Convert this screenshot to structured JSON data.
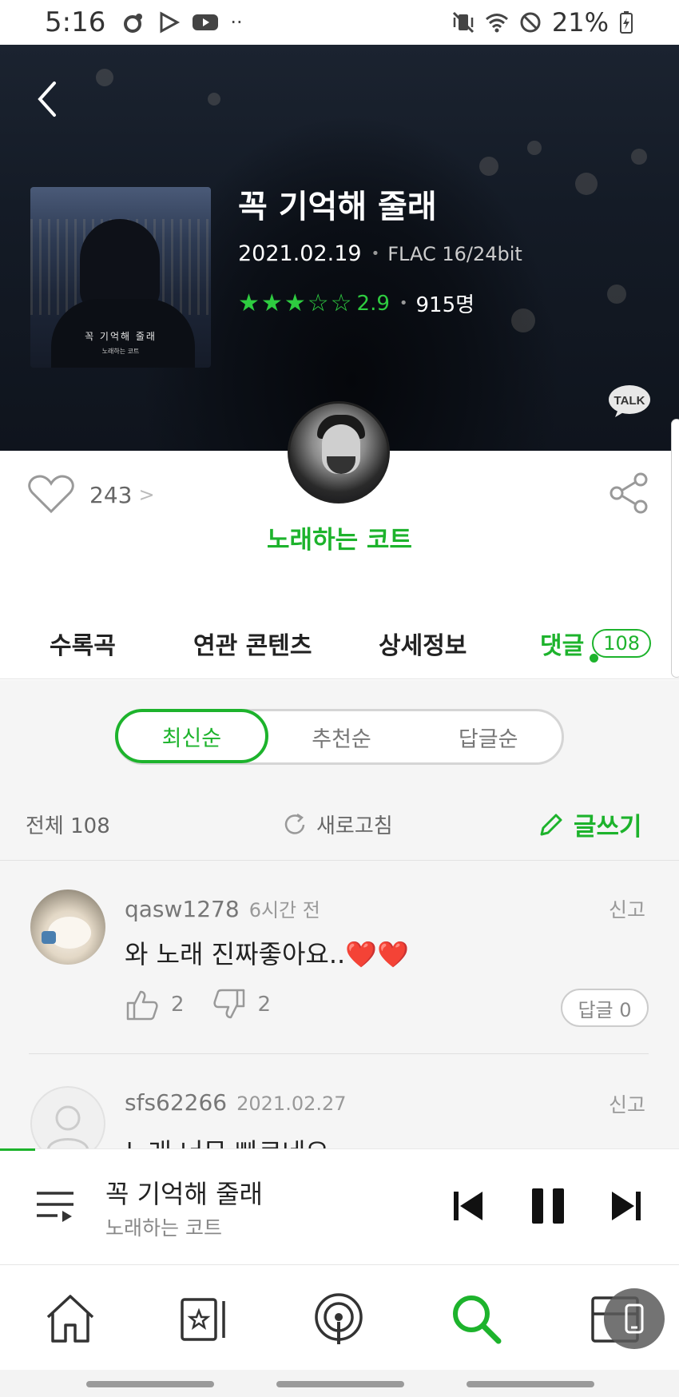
{
  "status_bar": {
    "time": "5:16",
    "battery": "21%"
  },
  "album": {
    "title": "꼭 기억해 줄래",
    "release_date": "2021.02.19",
    "format": "FLAC 16/24bit",
    "rating": "2.9",
    "rating_stars": 3,
    "rating_count": "915명",
    "art_title": "꼭 기억해 줄래",
    "art_subtitle": "노래하는 코트"
  },
  "talk_label": "TALK",
  "likes": {
    "count": "243",
    "chevron": ">"
  },
  "artist": {
    "name": "노래하는 코트"
  },
  "tabs": [
    {
      "label": "수록곡"
    },
    {
      "label": "연관 콘텐츠"
    },
    {
      "label": "상세정보"
    },
    {
      "label": "댓글",
      "badge": "108"
    }
  ],
  "sort": {
    "options": [
      "최신순",
      "추천순",
      "답글순"
    ],
    "selected": "최신순"
  },
  "list_bar": {
    "total": "전체 108",
    "refresh": "새로고침",
    "write": "글쓰기"
  },
  "comments": [
    {
      "user": "qasw1278",
      "time": "6시간 전",
      "report": "신고",
      "text": "와 노래 진짜좋아요..❤️❤️",
      "likes": "2",
      "dislikes": "2",
      "reply": "답글 0"
    },
    {
      "user": "sfs62266",
      "time": "2021.02.27",
      "report": "신고",
      "text": "노래 너무 빠르네요"
    }
  ],
  "mini_player": {
    "title": "꼭 기억해 줄래",
    "artist": "노래하는 코트"
  },
  "colors": {
    "accent": "#1db32c",
    "header_bg": "#141b26"
  },
  "icons": {
    "back": "chevron-left-icon",
    "talk": "kakaotalk-icon",
    "like": "heart-icon",
    "share": "share-icon",
    "refresh": "refresh-icon",
    "write": "pencil-icon",
    "thumb_up": "thumbs-up-icon",
    "thumb_down": "thumbs-down-icon",
    "playlist": "playlist-icon",
    "prev": "skip-previous-icon",
    "pause": "pause-icon",
    "next": "skip-next-icon",
    "nav": [
      "home-icon",
      "my-music-icon",
      "podcast-icon",
      "search-icon",
      "library-icon"
    ]
  }
}
